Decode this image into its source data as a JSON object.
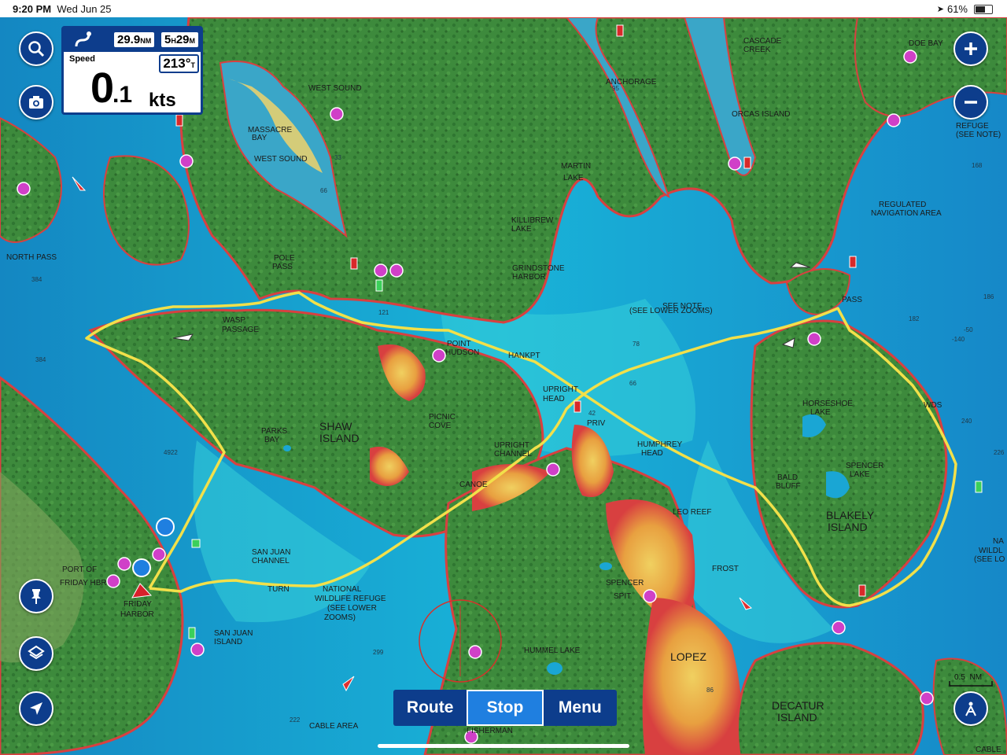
{
  "status_bar": {
    "time": "9:20 PM",
    "date": "Wed Jun 25",
    "battery": "61%",
    "battery_level": 0.61
  },
  "dashboard": {
    "distance": "29.9",
    "distance_unit": "NM",
    "eta_hours": "5",
    "eta_h_unit": "H",
    "eta_minutes": "29",
    "eta_m_unit": "M",
    "speed_label": "Speed",
    "speed_int": "0",
    "speed_dec": ".1",
    "speed_unit": "kts",
    "heading": "213°",
    "heading_unit": "T"
  },
  "bottom_bar": {
    "route": "Route",
    "stop": "Stop",
    "menu": "Menu"
  },
  "scale": {
    "label": "0.5",
    "unit": "NM"
  },
  "map_labels": {
    "west_sound_1": "WEST SOUND",
    "massacre_bay_1": "MASSACRE",
    "massacre_bay_2": "BAY",
    "west_sound_2": "WEST SOUND",
    "anchorage": "ANCHORAGE",
    "cascade_creek_1": "CASCADE",
    "cascade_creek_2": "CREEK",
    "doe_bay": "DOE BAY",
    "orcas_island": "ORCAS ISLAND",
    "martin_lake_1": "MARTIN",
    "martin_lake_2": "LAKE",
    "killibrew_lake_1": "KILLIBREW",
    "killibrew_lake_2": "LAKE",
    "grindstone_harbor_1": "GRINDSTONE",
    "grindstone_harbor_2": "HARBOR",
    "refuge_1": "REFUGE",
    "refuge_2": "(SEE NOTE)",
    "regulated_1": "REGULATED",
    "regulated_2": "NAVIGATION AREA",
    "north_pass": "NORTH PASS",
    "pole_pass_1": "POLE",
    "pole_pass_2": "PASS",
    "see_note_1": "SEE NOTE",
    "see_note_2": "(SEE LOWER ZOOMS)",
    "pass": "PASS",
    "wasp_passage_1": "WASP",
    "wasp_passage_2": "PASSAGE",
    "point_hudson_1": "POINT",
    "point_hudson_2": "HUDSON",
    "hankpt": "HANKPT",
    "upright_head_1": "UPRIGHT",
    "upright_head_2": "HEAD",
    "horseshoe_lake_1": "HORSESHOE",
    "horseshoe_lake_2": "LAKE",
    "wds": "WDS",
    "parks_bay_1": "PARKS",
    "parks_bay_2": "BAY",
    "shaw_island_1": "SHAW",
    "shaw_island_2": "ISLAND",
    "picnic_cove_1": "PICNIC",
    "picnic_cove_2": "COVE",
    "upright_channel_1": "UPRIGHT",
    "upright_channel_2": "CHANNEL",
    "priv": "PRIV",
    "humphrey_head_1": "HUMPHREY",
    "humphrey_head_2": "HEAD",
    "bald_bluff_1": "BALD",
    "bald_bluff_2": "BLUFF",
    "spencer_lake_1": "SPENCER",
    "spencer_lake_2": "LAKE",
    "canoe": "CANOE",
    "leo_reef": "LEO REEF",
    "blakely_1": "BLAKELY",
    "blakely_2": "ISLAND",
    "port_of_1": "PORT OF",
    "port_of_2": "FRIDAY HBR",
    "friday_harbor_1": "FRIDAY",
    "friday_harbor_2": "HARBOR",
    "san_juan_channel_1": "SAN JUAN",
    "san_juan_channel_2": "CHANNEL",
    "turn": "TURN",
    "nwr_1": "NATIONAL",
    "nwr_2": "WILDLIFE REFUGE",
    "nwr_3": "(SEE LOWER",
    "nwr_4": "ZOOMS)",
    "spencer_spit_1": "SPENCER",
    "spencer_spit_2": "SPIT",
    "frost": "FROST",
    "san_juan_island_1": "SAN JUAN",
    "san_juan_island_2": "ISLAND",
    "hummel_lake": "HUMMEL LAKE",
    "lopez": "LOPEZ",
    "decatur_1": "DECATUR",
    "decatur_2": "ISLAND",
    "cable_area": "CABLE AREA",
    "fisherman": "FISHERMAN",
    "refuge_right_1": "NA",
    "refuge_right_2": "WILDL",
    "refuge_right_3": "(SEE LO",
    "cable_right": "CABLE"
  },
  "depths": [
    "384",
    "384",
    "66",
    "95",
    "121",
    "78",
    "66",
    "42",
    "182",
    "168",
    "186",
    "-50",
    "-140",
    "240",
    "226",
    "4922",
    "299",
    "222",
    "86",
    "33"
  ]
}
